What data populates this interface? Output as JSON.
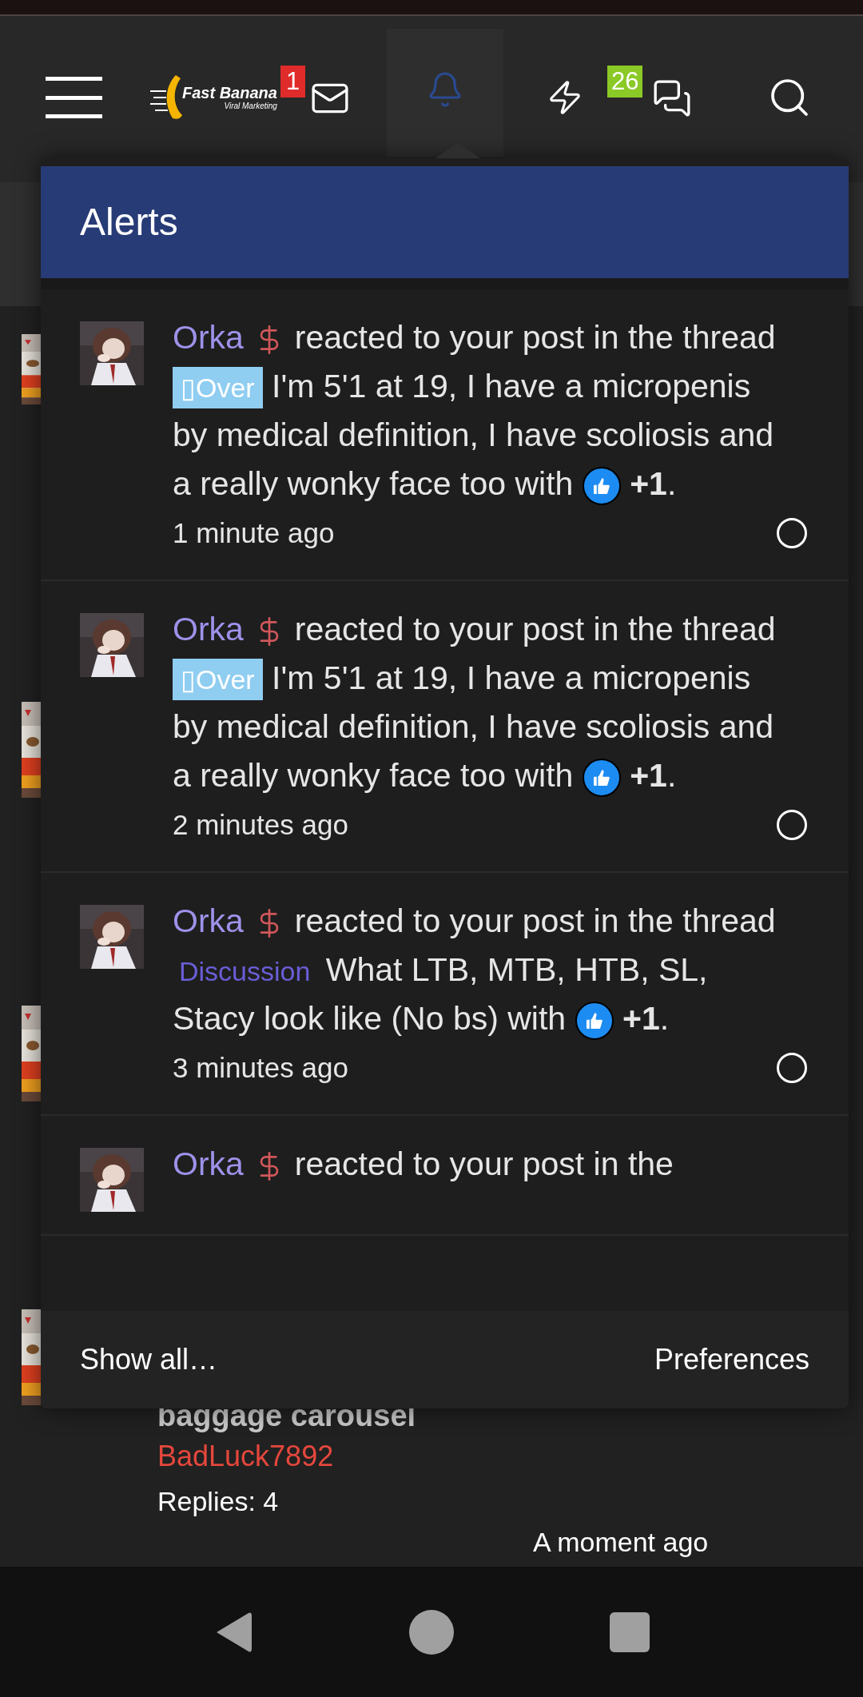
{
  "header": {
    "logo": {
      "name": "Fast Banana",
      "tagline": "Viral Marketing"
    },
    "message_badge": "1",
    "chat_badge": "26",
    "alerts_tab": {
      "selected": true
    }
  },
  "alerts": {
    "title": "Alerts",
    "items": [
      {
        "user": "Orka",
        "action": "reacted to your post in the thread",
        "prefix": {
          "kind": "over",
          "label": "▯Over"
        },
        "title": "I'm 5'1 at 19, I have a micropenis by medical definition, I have scoliosis and a really wonky face too with",
        "reaction": "**+1**.",
        "time": "1 minute ago",
        "read": false
      },
      {
        "user": "Orka",
        "action": "reacted to your post in the thread",
        "prefix": {
          "kind": "over",
          "label": "▯Over"
        },
        "title": "I'm 5'1 at 19, I have a micropenis by medical definition, I have scoliosis and a really wonky face too with",
        "reaction": "**+1**.",
        "time": "2 minutes ago",
        "read": false
      },
      {
        "user": "Orka",
        "action": "reacted to your post in the thread",
        "prefix": {
          "kind": "discussion",
          "label": "Discussion"
        },
        "title": "What LTB, MTB, HTB, SL, Stacy look like (No bs) with",
        "reaction": "**+1**.",
        "time": "3 minutes ago",
        "read": false
      },
      {
        "user": "Orka",
        "action": "reacted to your post in the"
      }
    ],
    "footer": {
      "show_all": "Show all…",
      "preferences": "Preferences"
    }
  },
  "thread": {
    "title": "baggage carousel",
    "author": "BadLuck7892",
    "replies": "Replies: 4",
    "time": "A moment ago"
  }
}
